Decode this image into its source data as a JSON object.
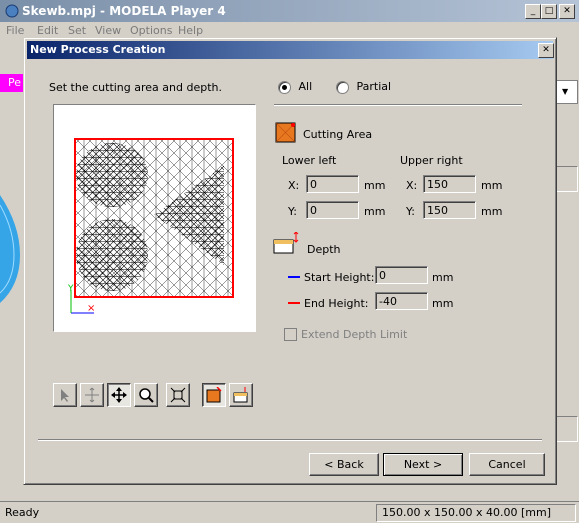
{
  "main_window": {
    "title": "Skewb.mpj - MODELA Player 4",
    "menu": [
      "File",
      "Edit",
      "Set",
      "View",
      "Options",
      "Help"
    ],
    "status_left": "Ready",
    "status_right": "150.00 x 150.00 x 40.00 [mm]",
    "side_label": "Pe"
  },
  "dialog": {
    "title": "New Process Creation",
    "instruction": "Set the cutting area and depth.",
    "area_mode": {
      "all_label": "All",
      "partial_label": "Partial",
      "selected": "All"
    },
    "cutting_area": {
      "label": "Cutting Area",
      "lower_left_label": "Lower left",
      "upper_right_label": "Upper right",
      "x_label": "X:",
      "y_label": "Y:",
      "unit": "mm",
      "lower_left": {
        "x": "0",
        "y": "0"
      },
      "upper_right": {
        "x": "150",
        "y": "150"
      }
    },
    "depth": {
      "label": "Depth",
      "start_height_label": "Start Height:",
      "start_height": "0",
      "end_height_label": "End Height:",
      "end_height": "-40",
      "unit": "mm",
      "extend_label": "Extend Depth Limit",
      "extend_checked": false
    },
    "buttons": {
      "back": "< Back",
      "next": "Next >",
      "cancel": "Cancel"
    },
    "colors": {
      "area_border": "#ff0000",
      "start_line": "#0000ff",
      "end_line": "#ff0000",
      "title_bar": "#0a246a"
    }
  }
}
